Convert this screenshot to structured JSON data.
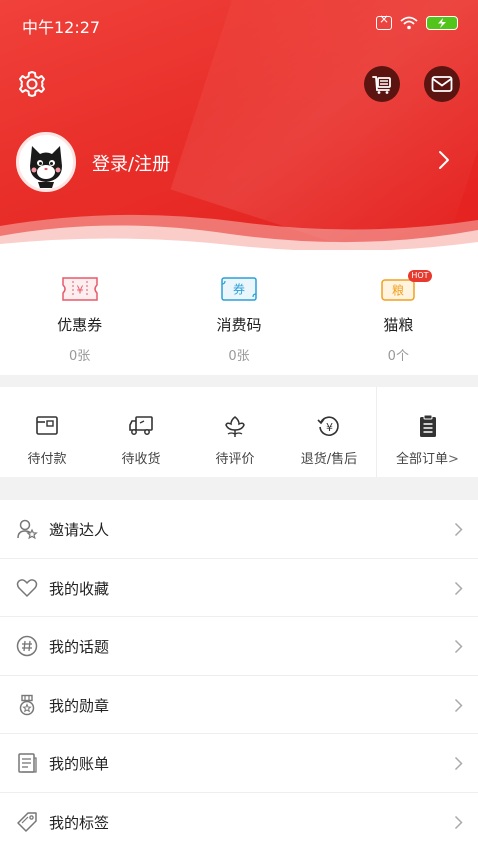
{
  "status_bar": {
    "time": "中午12:27"
  },
  "header": {
    "login_label": "登录/注册"
  },
  "assets": [
    {
      "icon": "coupon-icon",
      "icon_text": "¥",
      "title": "优惠券",
      "count": "0张"
    },
    {
      "icon": "voucher-code-icon",
      "icon_text": "券",
      "title": "消费码",
      "count": "0张"
    },
    {
      "icon": "cat-food-icon",
      "icon_text": "粮",
      "badge": "HOT",
      "title": "猫粮",
      "count": "0个"
    }
  ],
  "orders": [
    {
      "icon": "wallet-icon",
      "label": "待付款"
    },
    {
      "icon": "truck-icon",
      "label": "待收货"
    },
    {
      "icon": "review-flower-icon",
      "label": "待评价"
    },
    {
      "icon": "refund-icon",
      "label": "退货/售后"
    },
    {
      "icon": "clipboard-icon",
      "label": "全部订单"
    }
  ],
  "menu": [
    {
      "icon": "invite-user-icon",
      "label": "邀请达人"
    },
    {
      "icon": "heart-icon",
      "label": "我的收藏"
    },
    {
      "icon": "hashtag-icon",
      "label": "我的话题"
    },
    {
      "icon": "medal-icon",
      "label": "我的勋章"
    },
    {
      "icon": "bill-icon",
      "label": "我的账单"
    },
    {
      "icon": "tag-icon",
      "label": "我的标签"
    }
  ],
  "colors": {
    "header_red": "#e92f2a",
    "dark_button": "#5b1410",
    "battery_green": "#52c41a",
    "coupon_pink": "#e85a6a",
    "voucher_blue": "#2aa0d8",
    "catfood_orange": "#f0a020",
    "hot_badge": "#e63a2e"
  }
}
